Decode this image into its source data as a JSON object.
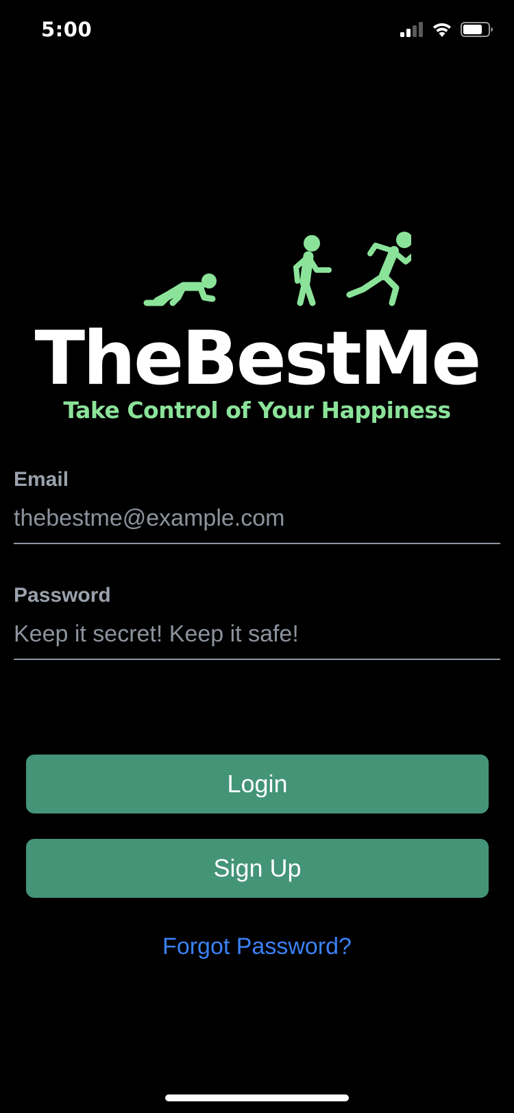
{
  "status_bar": {
    "time": "5:00",
    "icons": [
      "cellular-signal-icon",
      "wifi-icon",
      "battery-icon"
    ]
  },
  "logo": {
    "title": "TheBestMe",
    "tagline": "Take Control of Your Happiness",
    "figures": [
      "crawling-person-icon",
      "walking-person-icon",
      "running-person-icon"
    ],
    "accent_color": "#8be39a"
  },
  "form": {
    "email": {
      "label": "Email",
      "value": "",
      "placeholder": "thebestme@example.com"
    },
    "password": {
      "label": "Password",
      "value": "",
      "placeholder": "Keep it secret! Keep it safe!"
    }
  },
  "actions": {
    "login_label": "Login",
    "signup_label": "Sign Up",
    "forgot_label": "Forgot Password?",
    "button_color": "#449478",
    "link_color": "#3a82f7"
  }
}
